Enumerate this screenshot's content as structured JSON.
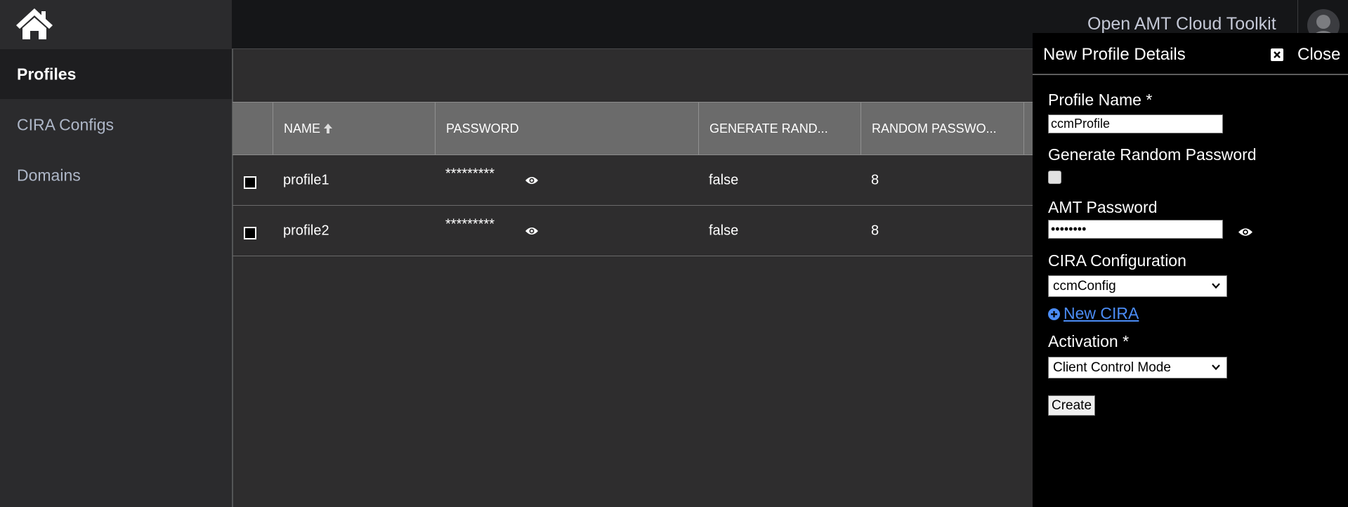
{
  "header": {
    "app_title": "Open AMT Cloud Toolkit",
    "home_icon": "home-icon",
    "avatar_icon": "user-avatar-icon"
  },
  "sidebar": {
    "items": [
      {
        "label": "Profiles",
        "active": true
      },
      {
        "label": "CIRA Configs",
        "active": false
      },
      {
        "label": "Domains",
        "active": false
      }
    ]
  },
  "table": {
    "columns": [
      "NAME",
      "PASSWORD",
      "GENERATE RAND...",
      "RANDOM PASSWO..."
    ],
    "sort": {
      "column": "NAME",
      "direction": "ascending"
    },
    "rows": [
      {
        "name": "profile1",
        "password": "*********",
        "generate_random": "false",
        "random_password_length": "8"
      },
      {
        "name": "profile2",
        "password": "*********",
        "generate_random": "false",
        "random_password_length": "8"
      }
    ]
  },
  "drawer": {
    "title": "New Profile Details",
    "close_label": "Close",
    "profile_name_label": "Profile Name *",
    "profile_name_value": "ccmProfile",
    "generate_random_label": "Generate Random Password",
    "generate_random_checked": false,
    "amt_password_label": "AMT Password",
    "amt_password_value": "••••••••",
    "cira_label": "CIRA Configuration",
    "cira_value": "ccmConfig",
    "new_cira_label": "New CIRA",
    "activation_label": "Activation *",
    "activation_value": "Client Control Mode",
    "create_label": "Create"
  },
  "colors": {
    "background": "#2e2d2e",
    "topbar": "#151618",
    "sidebar": "#2b2b2d",
    "sidebar_active": "#1e1e20",
    "table_header": "#6b6b6b",
    "drawer": "#000000",
    "link": "#4b8cf5"
  }
}
